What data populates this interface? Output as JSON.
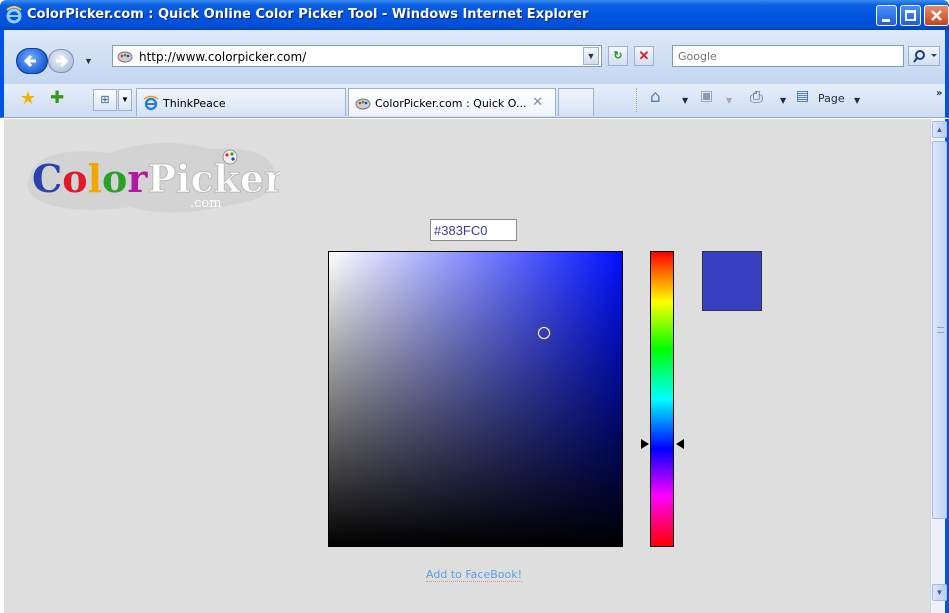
{
  "window": {
    "title": "ColorPicker.com : Quick Online Color Picker Tool - Windows Internet Explorer"
  },
  "address_bar": {
    "url": "http://www.colorpicker.com/",
    "search_placeholder": "Google"
  },
  "tabs": [
    {
      "label": "ThinkPeace",
      "active": false
    },
    {
      "label": "ColorPicker.com : Quick O...",
      "active": true
    }
  ],
  "command_bar": {
    "page_label": "Page"
  },
  "logo": {
    "text": "ColorPicker",
    "subtext": ".com"
  },
  "picker": {
    "hex_value": "#383FC0",
    "selected_color": "#383FC0",
    "hue_color": "#0010ff",
    "hue_degrees": 236
  },
  "footer": {
    "facebook_link": "Add to FaceBook!"
  },
  "colors": {
    "titlebar": "#0054e3",
    "content_bg": "#dedede",
    "link": "#5aa0e8"
  }
}
